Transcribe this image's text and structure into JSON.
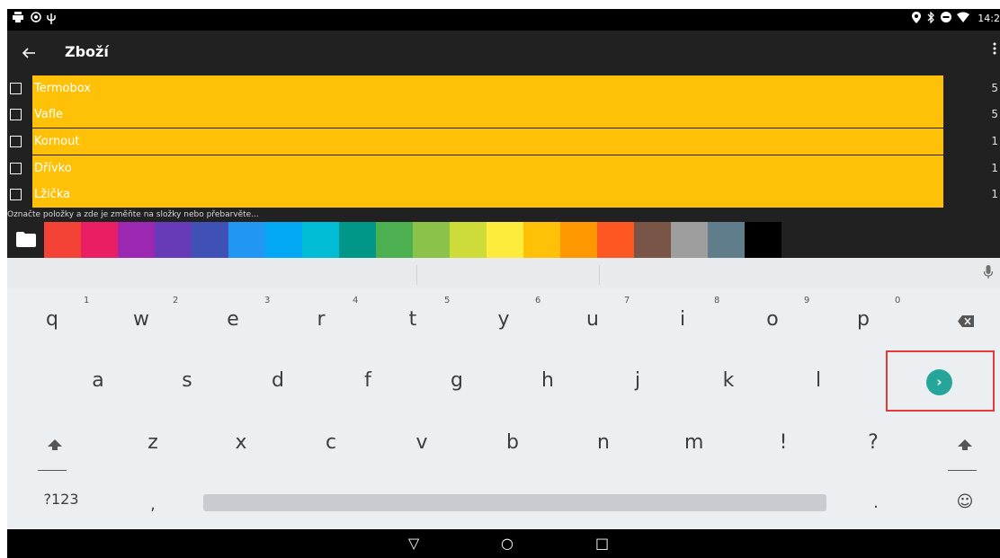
{
  "status_bar": {
    "time": "14:2",
    "left_icons": [
      "printer-icon",
      "shield-icon",
      "usb-icon"
    ],
    "right_icons": [
      "location-icon",
      "bluetooth-icon",
      "do-not-disturb-icon",
      "wifi-icon"
    ]
  },
  "app_bar": {
    "title": "Zboží"
  },
  "list": {
    "items": [
      {
        "name": "Termobox",
        "qty": "5"
      },
      {
        "name": "Vafle",
        "qty": "5"
      },
      {
        "name": "Kornout",
        "qty": "1"
      },
      {
        "name": "Dřívko",
        "qty": "1"
      },
      {
        "name": "Lžička",
        "qty": "1"
      }
    ],
    "hint": "Označte položky a zde je změňte na složky nebo přebarvěte...",
    "row_color": "#ffc107"
  },
  "palette": {
    "colors": [
      "#f44336",
      "#e91e63",
      "#9c27b0",
      "#673ab7",
      "#3f51b5",
      "#2196f3",
      "#03a9f4",
      "#00bcd4",
      "#009688",
      "#4caf50",
      "#8bc34a",
      "#cddc39",
      "#ffeb3b",
      "#ffc107",
      "#ff9800",
      "#ff5722",
      "#795548",
      "#9e9e9e",
      "#607d8b",
      "#000000"
    ]
  },
  "keyboard": {
    "row1": [
      "q",
      "w",
      "e",
      "r",
      "t",
      "y",
      "u",
      "i",
      "o",
      "p"
    ],
    "row1_hints": [
      "1",
      "2",
      "3",
      "4",
      "5",
      "6",
      "7",
      "8",
      "9",
      "0"
    ],
    "row2": [
      "a",
      "s",
      "d",
      "f",
      "g",
      "h",
      "j",
      "k",
      "l"
    ],
    "row3": [
      "z",
      "x",
      "c",
      "v",
      "b",
      "n",
      "m",
      "!",
      "?"
    ],
    "symbols_label": "?123",
    "comma": ",",
    "period": ".",
    "emoji": "☺",
    "enter_glyph": "›",
    "accent": "#26a69a",
    "highlight_color": "#e53935"
  },
  "nav_bar": {
    "back": "▽",
    "home": "○",
    "recents": "□"
  }
}
